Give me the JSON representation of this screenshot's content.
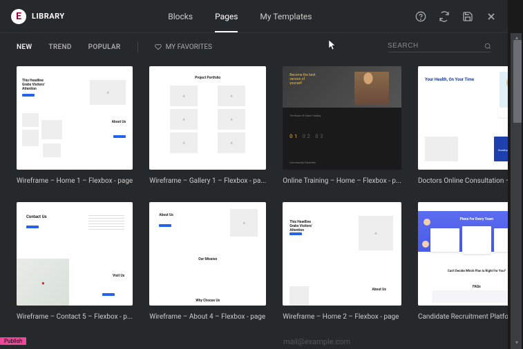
{
  "header": {
    "logo_letter": "E",
    "title": "LIBRARY",
    "tabs": [
      {
        "label": "Blocks",
        "active": false
      },
      {
        "label": "Pages",
        "active": true
      },
      {
        "label": "My Templates",
        "active": false
      }
    ]
  },
  "filters": {
    "items": [
      {
        "label": "NEW",
        "active": true
      },
      {
        "label": "TREND",
        "active": false
      },
      {
        "label": "POPULAR",
        "active": false
      }
    ],
    "favorites_label": "MY FAVORITES"
  },
  "search": {
    "placeholder": "SEARCH"
  },
  "templates": [
    {
      "title": "Wireframe – Home 1 – Flexbox - page",
      "thumb": {
        "headline": "This Headline Grabs Visitors' Attention",
        "about": "About Us"
      }
    },
    {
      "title": "Wireframe – Gallery 1 – Flexbox - pa...",
      "thumb": {
        "headline": "Project Portfolio"
      }
    },
    {
      "title": "Online Training – Home – Flexbox - p...",
      "thumb": {
        "headline": "Become the best version of yourself",
        "sub": "The Power Of Online Training",
        "nums": "01 02 03",
        "foot": "Community Favorites"
      }
    },
    {
      "title": "Doctors Online Consultation – Flexb...",
      "thumb": {
        "headline": "Your Health, On Your Time",
        "box": "Goodbye Waiting Rooms"
      }
    },
    {
      "title": "Wireframe – Contact 5 – Flexbox - p...",
      "thumb": {
        "headline": "Contact Us",
        "visit": "Visit Us"
      }
    },
    {
      "title": "Wireframe – About 4 – Flexbox - page",
      "thumb": {
        "about": "About Us",
        "mission": "Our Mission",
        "why": "Why Choose Us"
      }
    },
    {
      "title": "Wireframe – Home 2 – Flexbox - page",
      "thumb": {
        "headline": "This Headline Grabs Visitors' Attention",
        "about": "About Us"
      }
    },
    {
      "title": "Candidate Recruitment Platform - pa...",
      "thumb": {
        "headline": "Plans For Every Team",
        "question": "Can't Decide Which Plan Is Right For You?",
        "faq": "FAQs"
      }
    }
  ],
  "footer": {
    "publish": "Publish",
    "email": "mail@example.com"
  }
}
